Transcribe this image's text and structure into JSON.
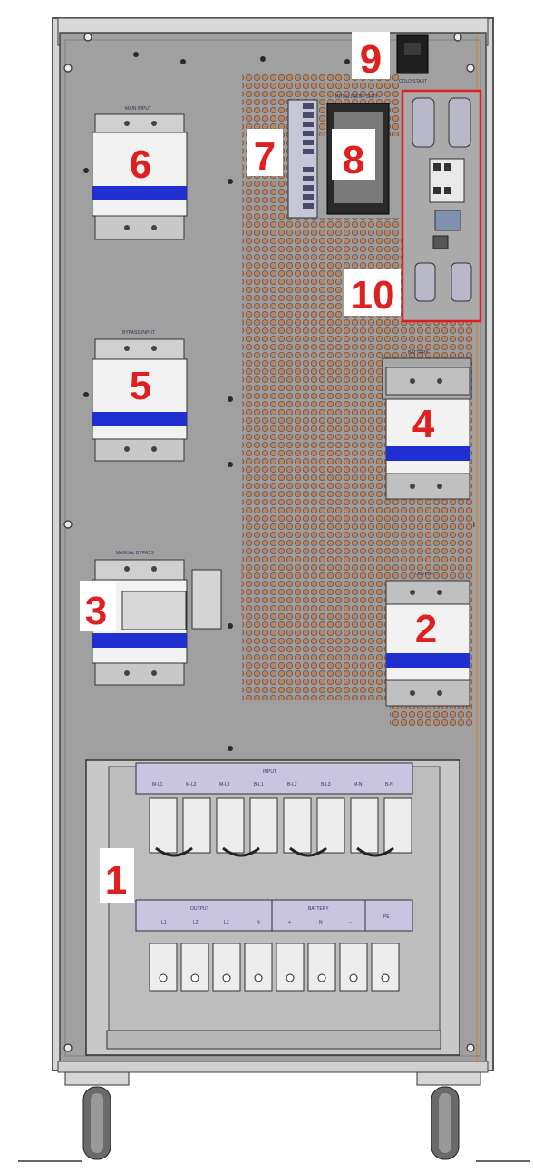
{
  "callouts": {
    "n1": "1",
    "n2": "2",
    "n3": "3",
    "n4": "4",
    "n5": "5",
    "n6": "6",
    "n7": "7",
    "n8": "8",
    "n9": "9",
    "n10": "10"
  },
  "labels": {
    "main_input": "MAIN INPUT",
    "bypass_input": "BYPASS INPUT",
    "manual_bypass": "MANUAL BYPASS",
    "intelligent_slot": "INTELLIGENT SLOT",
    "cold_start": "COLD START",
    "output_breaker": "OUTPUT",
    "battery_breaker": "BATTERY",
    "input_block": "INPUT",
    "output_block": "OUTPUT",
    "battery_block": "BATTERY",
    "pe": "PE",
    "input_terminals": [
      "M-L1",
      "M-L2",
      "M-L3",
      "B-L1",
      "B-L2",
      "B-L3",
      "M-N",
      "B-N"
    ],
    "output_terminals": [
      "L1",
      "L2",
      "L3",
      "N"
    ],
    "battery_terminals": [
      "+",
      "N",
      "−"
    ]
  },
  "colors": {
    "callout": "#e02020",
    "highlight_box": "#e02020",
    "panel": "#9e9e9e",
    "vent": "#b07f60",
    "breaker_blue": "#1f2fd0"
  }
}
